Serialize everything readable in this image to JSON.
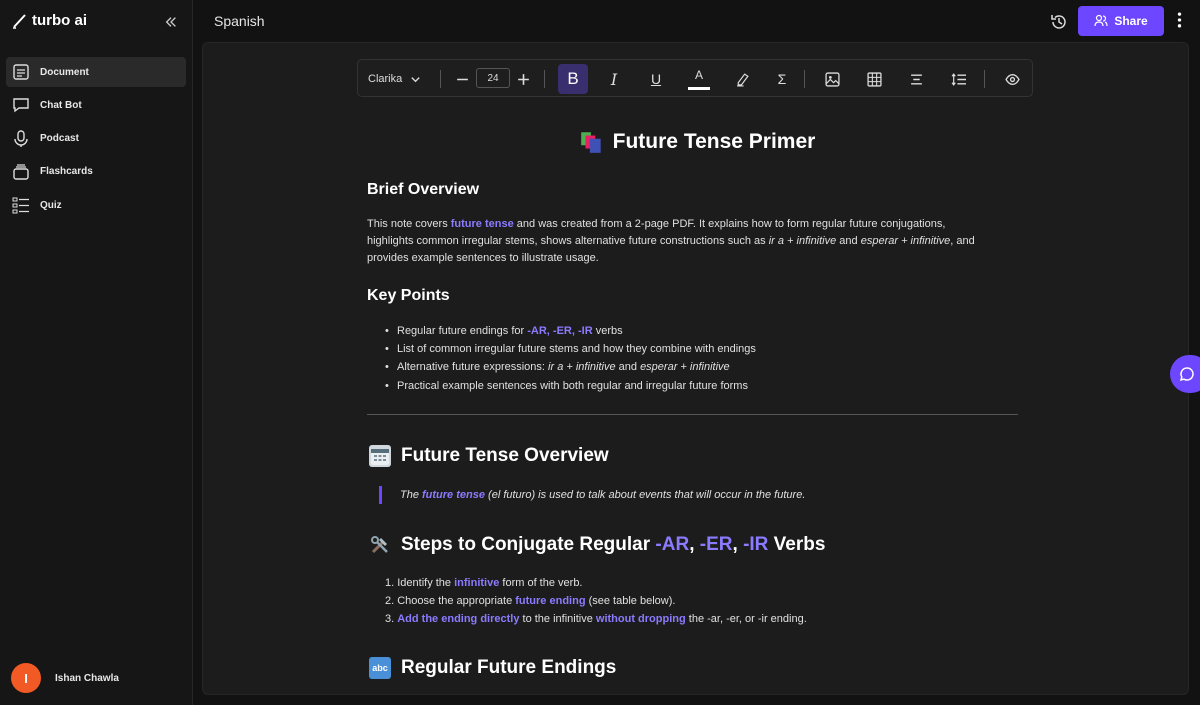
{
  "app": {
    "name": "turbo ai"
  },
  "sidebar": {
    "items": [
      {
        "label": "Document",
        "icon": "document-icon",
        "active": true
      },
      {
        "label": "Chat Bot",
        "icon": "chat-icon"
      },
      {
        "label": "Podcast",
        "icon": "microphone-icon"
      },
      {
        "label": "Flashcards",
        "icon": "cards-icon"
      },
      {
        "label": "Quiz",
        "icon": "checklist-icon"
      }
    ],
    "user": {
      "initial": "I",
      "name": "Ishan Chawla"
    }
  },
  "header": {
    "title": "Spanish",
    "share_label": "Share"
  },
  "toolbar": {
    "font": "Clarika",
    "font_size": "24",
    "bold_label": "B",
    "italic_label": "I",
    "underline_label": "U",
    "color_label": "A",
    "formula_label": "Σ"
  },
  "doc": {
    "title": "Future Tense Primer",
    "overview_heading": "Brief Overview",
    "overview": {
      "p1": "This note covers ",
      "hl1": "future tense",
      "p2": " and was created from a 2-page PDF. It explains how to form regular future conjugations,",
      "p3": "highlights common irregular stems, shows alternative future constructions such as ",
      "em1": "ir a + infinitive",
      "p4": " and ",
      "em2": "esperar + infinitive",
      "p5": ", and",
      "p6": "provides example sentences to illustrate usage."
    },
    "keypoints_heading": "Key Points",
    "kp1_a": "Regular future endings for ",
    "kp1_hl": "-AR, -ER, -IR",
    "kp1_b": " verbs",
    "kp2": "List of common irregular future stems and how they combine with endings",
    "kp3_a": "Alternative future expressions: ",
    "kp3_em1": "ir a + infinitive",
    "kp3_b": " and ",
    "kp3_em2": "esperar + infinitive",
    "kp4": "Practical example sentences with both regular and irregular future forms",
    "section1_heading": "Future Tense Overview",
    "quote_a": "The ",
    "quote_hl": "future tense",
    "quote_b": " (el futuro) is used to talk about events that will occur in the future.",
    "section2_a": "Steps to Conjugate Regular ",
    "section2_ar": "-AR",
    "section2_c1": ", ",
    "section2_er": "-ER",
    "section2_c2": ", ",
    "section2_ir": "-IR",
    "section2_b": " Verbs",
    "step1_a": "1. Identify the ",
    "step1_hl": "infinitive",
    "step1_b": " form of the verb.",
    "step2_a": "2. Choose the appropriate ",
    "step2_hl": "future ending",
    "step2_b": " (see table below).",
    "step3_num": "3. ",
    "step3_hl1": "Add the ending directly",
    "step3_a": " to the infinitive ",
    "step3_hl2": "without dropping",
    "step3_b": " the -ar, -er, or -ir ending.",
    "section3_heading": "Regular Future Endings",
    "abc_label": "abc"
  },
  "colors": {
    "accent": "#6c47ff",
    "highlight": "#8b7bff",
    "avatar": "#f15a24"
  }
}
